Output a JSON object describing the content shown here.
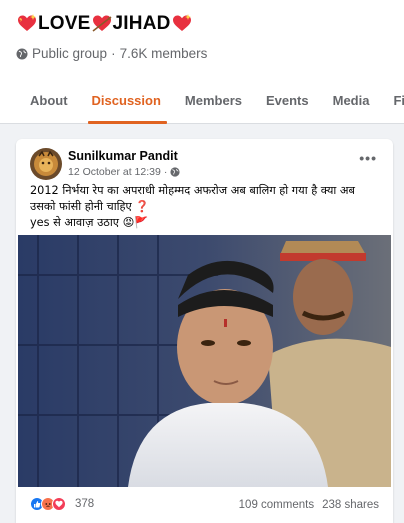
{
  "group": {
    "title_word1": "LOVE",
    "title_word2": "JIHAD",
    "privacy": "Public group",
    "separator": "·",
    "members": "7.6K members"
  },
  "tabs": [
    {
      "label": "About",
      "active": false
    },
    {
      "label": "Discussion",
      "active": true
    },
    {
      "label": "Members",
      "active": false
    },
    {
      "label": "Events",
      "active": false
    },
    {
      "label": "Media",
      "active": false
    },
    {
      "label": "Files",
      "active": false
    }
  ],
  "post": {
    "author": "Sunilkumar Pandit",
    "timestamp": "12 October at 12:39",
    "separator": "·",
    "more_label": "•••",
    "text_line1": "2012 निर्भया रेप का अपराधी मोहम्मद अफरोज अब बालिग हो गया है क्या अब",
    "text_line2": "उसको फांसी होनी चाहिए ❓",
    "text_line3": "yes से आवाज़ उठाए 😡🚩",
    "reaction_count": "378",
    "comments": "109 comments",
    "shares": "238 shares"
  },
  "colors": {
    "accent": "#e06321",
    "like": "#1877f2",
    "angry": "#f7714c",
    "love": "#f33e58"
  }
}
